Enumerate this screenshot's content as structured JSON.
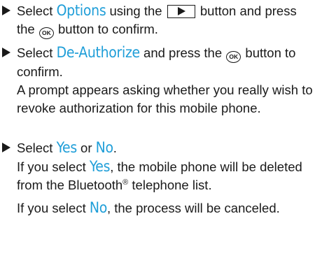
{
  "steps": [
    {
      "t1": "Select ",
      "hl1": "Options",
      "t2": " using the ",
      "t3": " button and press the ",
      "ok": "OK",
      "t4": " button to confirm."
    },
    {
      "t1": "Select ",
      "hl1": "De-Authorize",
      "t2": " and press the ",
      "ok": "OK",
      "t3": " button to confirm.",
      "note": "A prompt appears asking whether you really wish to revoke authorization for this mobile phone."
    },
    {
      "t1": "Select ",
      "hl1": "Yes",
      "t2": " or ",
      "hl2": "No",
      "t3": ".",
      "p2_t1": "If you select ",
      "p2_hl": "Yes",
      "p2_t2": ", the mobile phone will be deleted from the Bluetooth",
      "p2_reg": "®",
      "p2_t3": " telephone list.",
      "p3_t1": "If you select ",
      "p3_hl": "No",
      "p3_t2": ", the process will be canceled."
    }
  ],
  "colors": {
    "highlight": "#1f9ed8",
    "text": "#1a1a1a"
  },
  "icons": [
    "right-arrow-bullet-icon",
    "play-button-icon",
    "ok-button-icon"
  ]
}
